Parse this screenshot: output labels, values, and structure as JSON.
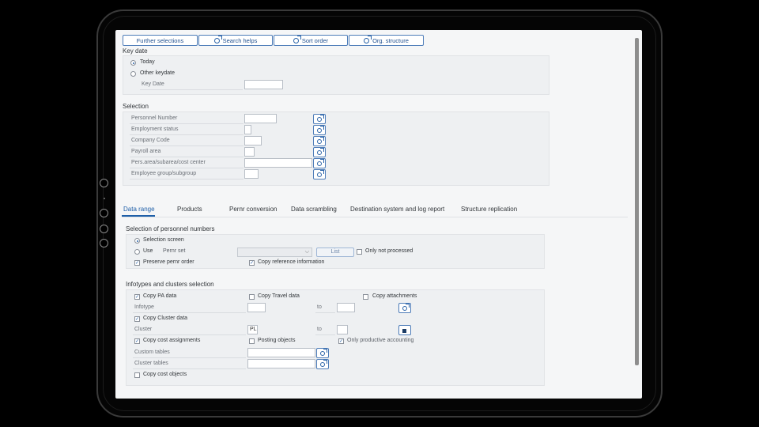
{
  "toolbar": {
    "further_selections": "Further selections",
    "search_helps": "Search helps",
    "sort_order": "Sort order",
    "org_structure": "Org. structure"
  },
  "key_date": {
    "title": "Key date",
    "today": "Today",
    "other": "Other keydate",
    "key_date_label": "Key Date",
    "key_date_value": ""
  },
  "selection": {
    "title": "Selection",
    "rows": [
      {
        "label": "Personnel Number"
      },
      {
        "label": "Employment status"
      },
      {
        "label": "Company Code"
      },
      {
        "label": "Payroll area"
      },
      {
        "label": "Pers.area/subarea/cost center"
      },
      {
        "label": "Employee group/subgroup"
      }
    ]
  },
  "tabs": [
    "Data range",
    "Products",
    "Pernr conversion",
    "Data scrambling",
    "Destination system and log report",
    "Structure replication"
  ],
  "personnel": {
    "title": "Selection of personnel numbers",
    "selection_screen": "Selection screen",
    "use": "Use",
    "pernr_set": "Pernr set",
    "list": "List",
    "only_not_processed": "Only not processed",
    "preserve": "Preserve pernr order",
    "copy_reference": "Copy reference information"
  },
  "infotypes": {
    "title": "Infotypes and clusters selection",
    "copy_pa": "Copy PA data",
    "copy_travel": "Copy Travel data",
    "copy_attachments": "Copy attachments",
    "infotype": "Infotype",
    "to": "to",
    "copy_cluster": "Copy Cluster data",
    "cluster": "Cluster",
    "cluster_value": "PL",
    "copy_cost": "Copy cost assignments",
    "posting_objects": "Posting objects",
    "only_productive": "Only productive accounting",
    "custom_tables": "Custom tables",
    "cluster_tables": "Cluster tables",
    "copy_cost_objects": "Copy cost objects"
  }
}
